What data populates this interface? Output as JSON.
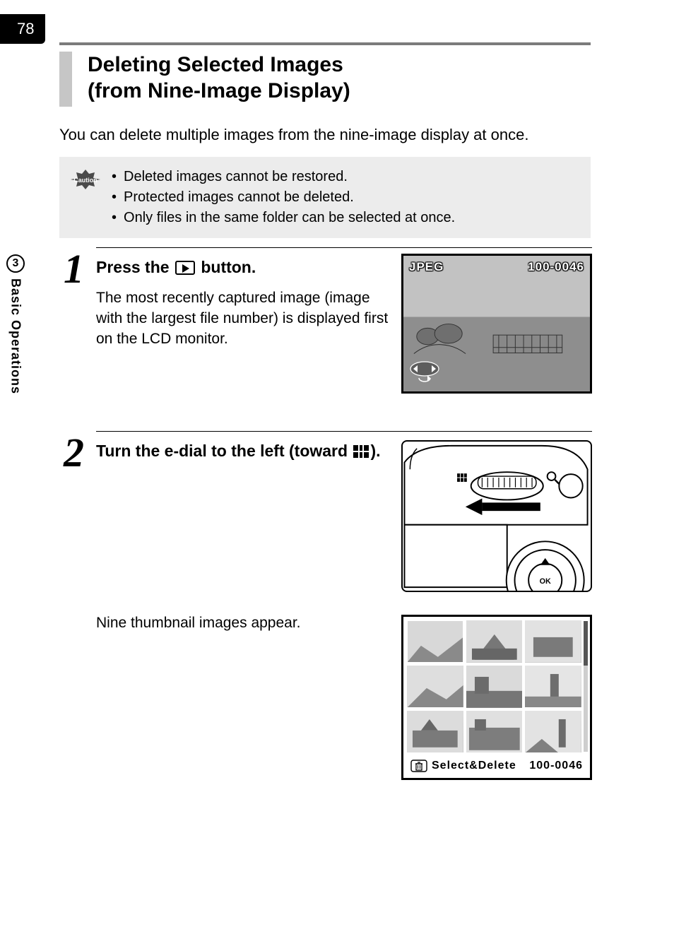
{
  "page_number": "78",
  "sidebar": {
    "chapter_number": "3",
    "chapter_label": "Basic Operations"
  },
  "heading": {
    "line1": "Deleting Selected Images",
    "line2": "(from Nine-Image Display)"
  },
  "intro": "You can delete multiple images from the nine-image display at once.",
  "caution": {
    "label": "Caution",
    "items": [
      "Deleted images cannot be restored.",
      "Protected images cannot be deleted.",
      "Only files in the same folder can be selected at once."
    ]
  },
  "steps": {
    "s1": {
      "num": "1",
      "head_prefix": "Press the ",
      "head_suffix": " button.",
      "body": "The most recently captured image (image with the largest file number) is displayed first on the LCD monitor.",
      "preview": {
        "format": "JPEG",
        "file_no": "100-0046"
      }
    },
    "s2": {
      "num": "2",
      "head_prefix": "Turn the e-dial to the left (toward ",
      "head_suffix": ").",
      "row2_text": "Nine thumbnail images appear.",
      "footer_action": "Select&Delete",
      "footer_file_no": "100-0046"
    }
  }
}
